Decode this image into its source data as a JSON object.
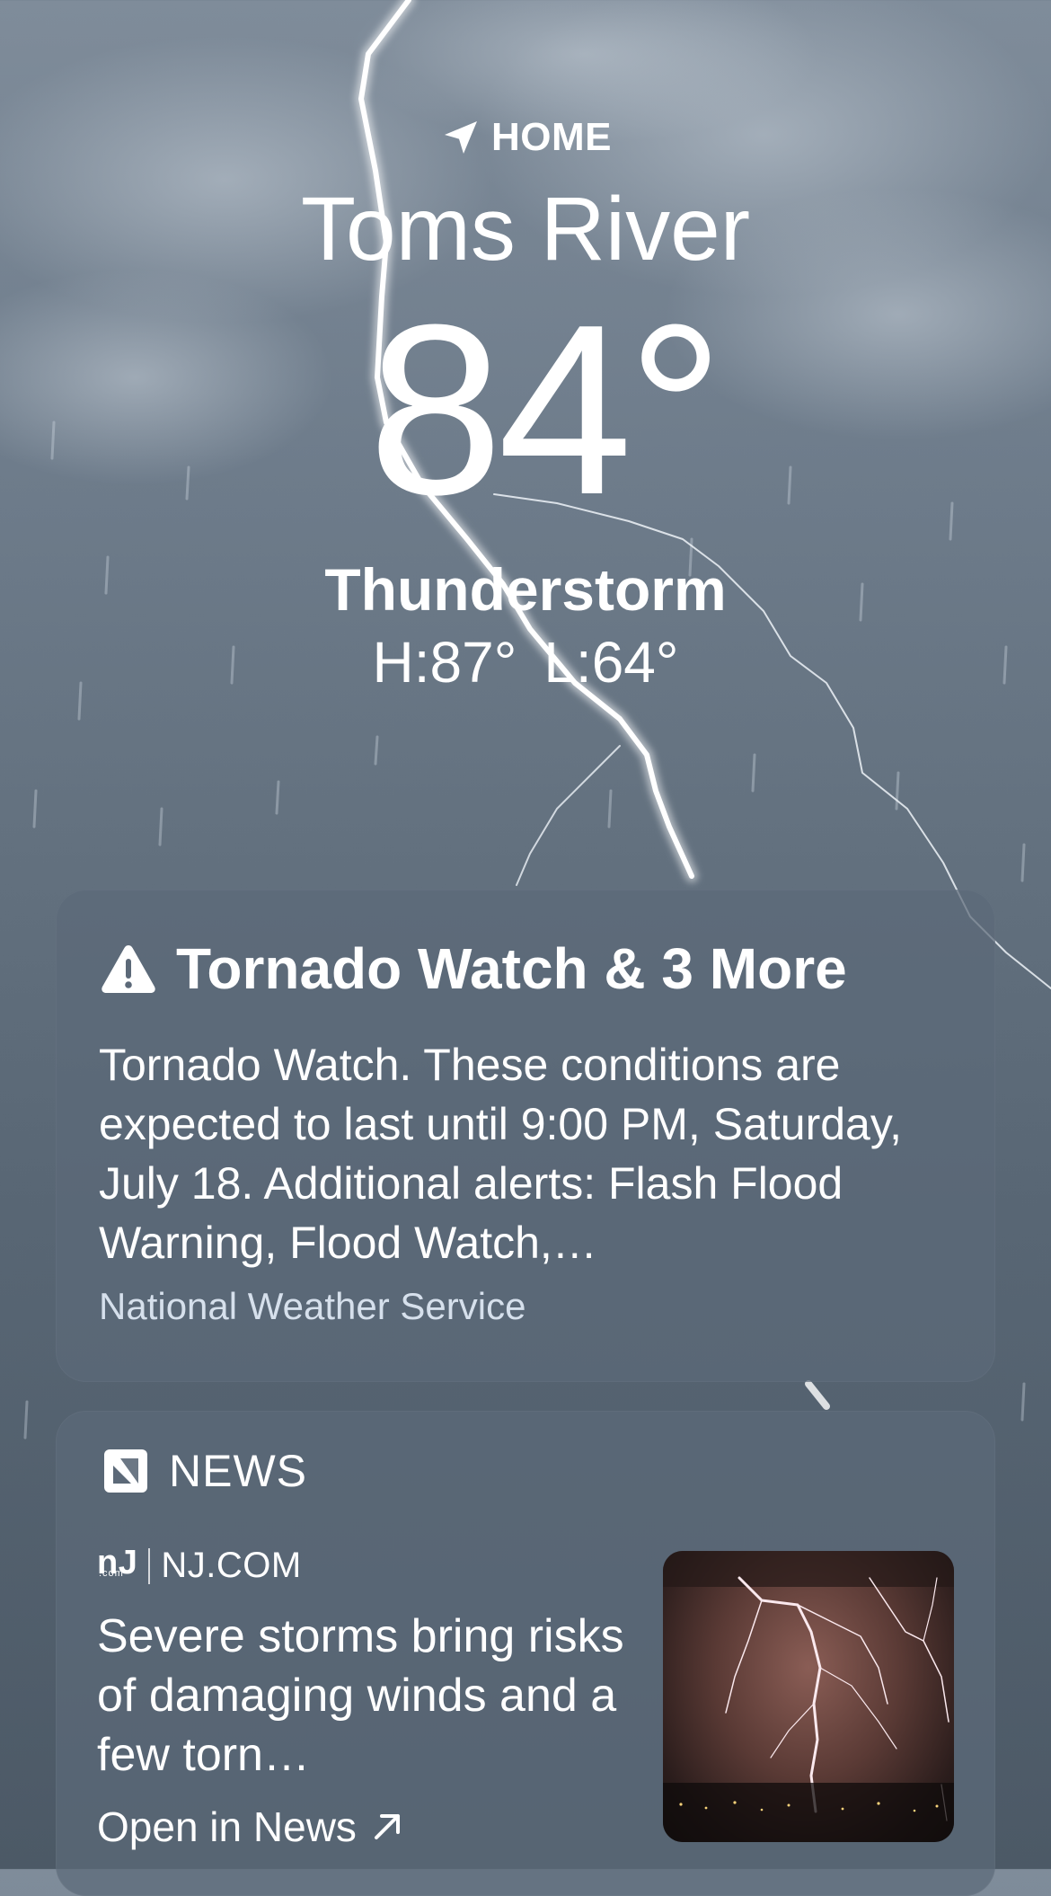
{
  "location": {
    "home_label": "HOME",
    "city": "Toms River"
  },
  "current": {
    "temperature": "84°",
    "condition": "Thunderstorm",
    "high": "H:87°",
    "low": "L:64°"
  },
  "alert": {
    "title": "Tornado Watch & 3 More",
    "body": "Tornado Watch. These conditions are expected to last until 9:00 PM, Saturday, July 18. Additional alerts: Flash Flood Warning, Flood Watch,…",
    "source": "National Weather Service"
  },
  "news": {
    "header": "NEWS",
    "publisher_logo": "nJ",
    "publisher_logo_sub": ".com",
    "publisher": "NJ.COM",
    "headline": "Severe storms bring risks of damaging winds and a few torn…",
    "open_label": "Open in News"
  },
  "colors": {
    "card_background": "#5c6978",
    "source_text": "#d6e0ec"
  }
}
